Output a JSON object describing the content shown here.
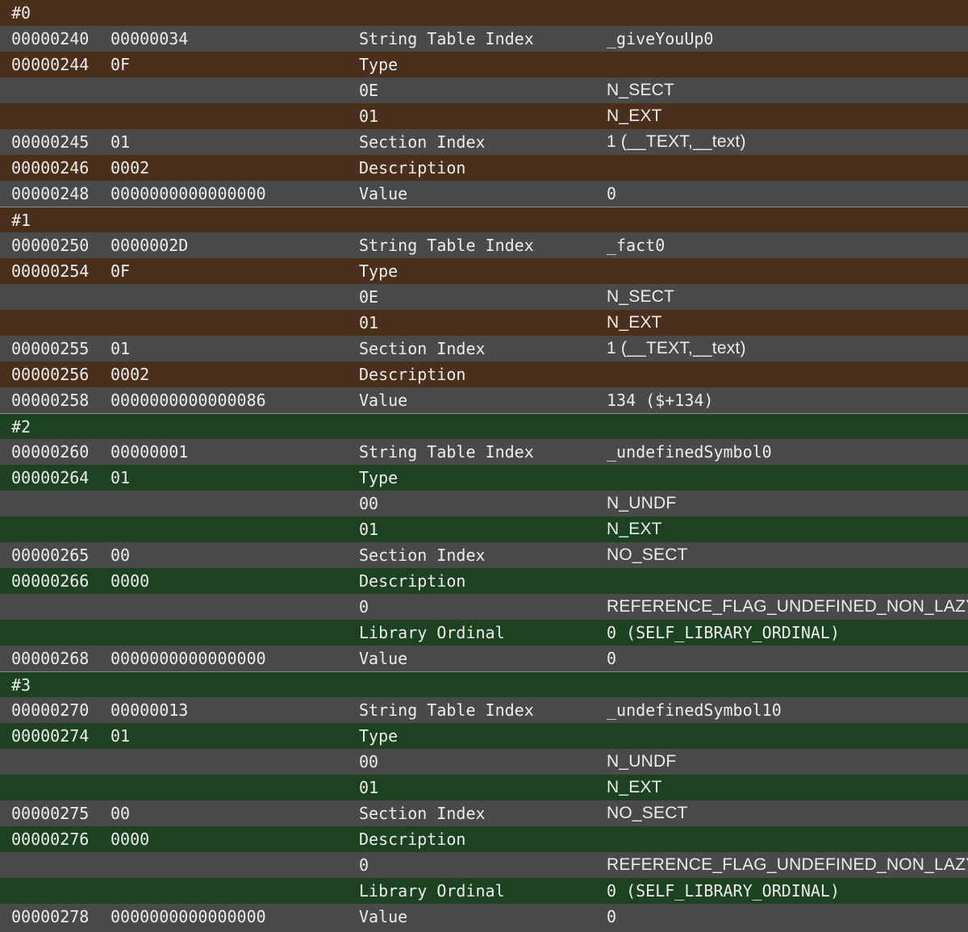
{
  "colors": {
    "grey_row": "#4a4a4a",
    "brown_row": "#4a2f1d",
    "green_row": "#1d4221",
    "text": "#ececec"
  },
  "symbols": [
    {
      "theme": "brown",
      "title": "#0",
      "rows": [
        {
          "offset": "00000240",
          "data": "00000034",
          "desc": "String Table Index",
          "value": "_giveYouUp0"
        },
        {
          "offset": "00000244",
          "data": "0F",
          "desc": "Type",
          "value": ""
        },
        {
          "offset": "",
          "data": "",
          "desc": "0E",
          "value": "N_SECT"
        },
        {
          "offset": "",
          "data": "",
          "desc": "01",
          "value": "N_EXT"
        },
        {
          "offset": "00000245",
          "data": "01",
          "desc": "Section Index",
          "value": "1 (__TEXT,__text)"
        },
        {
          "offset": "00000246",
          "data": "0002",
          "desc": "Description",
          "value": ""
        },
        {
          "offset": "00000248",
          "data": "0000000000000000",
          "desc": "Value",
          "value": "0"
        }
      ]
    },
    {
      "theme": "brown",
      "title": "#1",
      "rows": [
        {
          "offset": "00000250",
          "data": "0000002D",
          "desc": "String Table Index",
          "value": "_fact0"
        },
        {
          "offset": "00000254",
          "data": "0F",
          "desc": "Type",
          "value": ""
        },
        {
          "offset": "",
          "data": "",
          "desc": "0E",
          "value": "N_SECT"
        },
        {
          "offset": "",
          "data": "",
          "desc": "01",
          "value": "N_EXT"
        },
        {
          "offset": "00000255",
          "data": "01",
          "desc": "Section Index",
          "value": "1 (__TEXT,__text)"
        },
        {
          "offset": "00000256",
          "data": "0002",
          "desc": "Description",
          "value": ""
        },
        {
          "offset": "00000258",
          "data": "0000000000000086",
          "desc": "Value",
          "value": "134 ($+134)"
        }
      ]
    },
    {
      "theme": "green",
      "title": "#2",
      "rows": [
        {
          "offset": "00000260",
          "data": "00000001",
          "desc": "String Table Index",
          "value": "_undefinedSymbol0"
        },
        {
          "offset": "00000264",
          "data": "01",
          "desc": "Type",
          "value": ""
        },
        {
          "offset": "",
          "data": "",
          "desc": "00",
          "value": "N_UNDF"
        },
        {
          "offset": "",
          "data": "",
          "desc": "01",
          "value": "N_EXT"
        },
        {
          "offset": "00000265",
          "data": "00",
          "desc": "Section Index",
          "value": "NO_SECT"
        },
        {
          "offset": "00000266",
          "data": "0000",
          "desc": "Description",
          "value": ""
        },
        {
          "offset": "",
          "data": "",
          "desc": "0",
          "value": "REFERENCE_FLAG_UNDEFINED_NON_LAZY"
        },
        {
          "offset": "",
          "data": "",
          "desc": "Library Ordinal",
          "value": "0 (SELF_LIBRARY_ORDINAL)"
        },
        {
          "offset": "00000268",
          "data": "0000000000000000",
          "desc": "Value",
          "value": "0"
        }
      ]
    },
    {
      "theme": "green",
      "title": "#3",
      "rows": [
        {
          "offset": "00000270",
          "data": "00000013",
          "desc": "String Table Index",
          "value": "_undefinedSymbol10"
        },
        {
          "offset": "00000274",
          "data": "01",
          "desc": "Type",
          "value": ""
        },
        {
          "offset": "",
          "data": "",
          "desc": "00",
          "value": "N_UNDF"
        },
        {
          "offset": "",
          "data": "",
          "desc": "01",
          "value": "N_EXT"
        },
        {
          "offset": "00000275",
          "data": "00",
          "desc": "Section Index",
          "value": "NO_SECT"
        },
        {
          "offset": "00000276",
          "data": "0000",
          "desc": "Description",
          "value": ""
        },
        {
          "offset": "",
          "data": "",
          "desc": "0",
          "value": "REFERENCE_FLAG_UNDEFINED_NON_LAZY"
        },
        {
          "offset": "",
          "data": "",
          "desc": "Library Ordinal",
          "value": "0 (SELF_LIBRARY_ORDINAL)"
        },
        {
          "offset": "00000278",
          "data": "0000000000000000",
          "desc": "Value",
          "value": "0"
        }
      ]
    }
  ]
}
